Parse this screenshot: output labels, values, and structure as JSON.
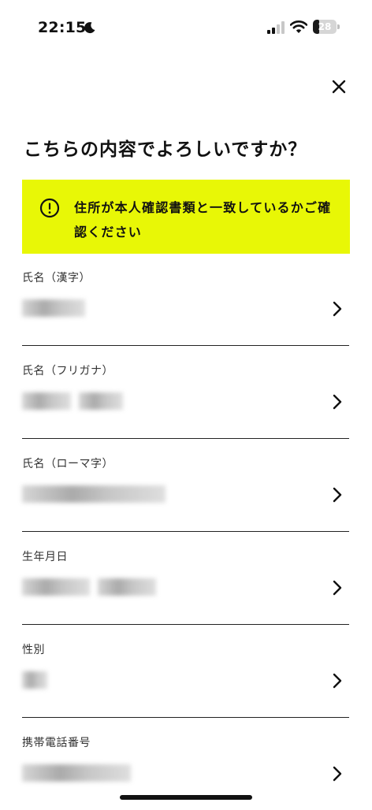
{
  "status_bar": {
    "time": "22:15",
    "battery_level": "28",
    "battery_fraction": 0.28
  },
  "header": {
    "title": "こちらの内容でよろしいですか？"
  },
  "notice": {
    "text": "住所が本人確認書類と一致しているかご確認ください"
  },
  "fields": [
    {
      "label": "氏名（漢字）"
    },
    {
      "label": "氏名（フリガナ）"
    },
    {
      "label": "氏名（ローマ字）"
    },
    {
      "label": "生年月日"
    },
    {
      "label": "性別"
    },
    {
      "label": "携帯電話番号"
    }
  ]
}
